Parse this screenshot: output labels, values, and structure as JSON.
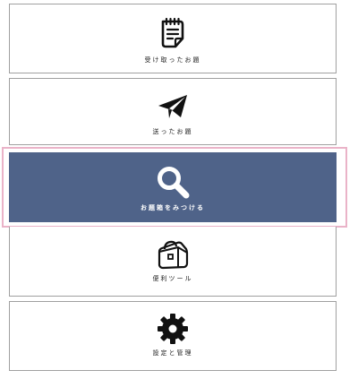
{
  "menu": {
    "items": [
      {
        "id": "received",
        "label": "受け取ったお題",
        "icon": "notepad-icon",
        "selected": false
      },
      {
        "id": "sent",
        "label": "送ったお題",
        "icon": "paper-plane-icon",
        "selected": false
      },
      {
        "id": "find",
        "label": "お題箱をみつける",
        "icon": "search-icon",
        "selected": true
      },
      {
        "id": "tools",
        "label": "便利ツール",
        "icon": "toolbox-icon",
        "selected": false
      },
      {
        "id": "settings",
        "label": "設定と管理",
        "icon": "gear-icon",
        "selected": false
      }
    ]
  },
  "colors": {
    "selected_background": "#4f6389",
    "selected_text": "#ffffff",
    "highlight_border": "#eab3c8",
    "border": "#a0a0a0",
    "icon": "#111111"
  }
}
